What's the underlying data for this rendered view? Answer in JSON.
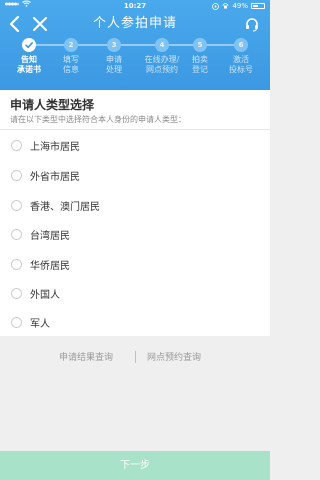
{
  "status_bar": {
    "time": "10:27",
    "battery": "49%"
  },
  "nav": {
    "title": "个人参拍申请"
  },
  "steps": [
    {
      "num": "",
      "label": "告知\n承诺书",
      "active": true
    },
    {
      "num": "2",
      "label": "填写\n信息",
      "active": false
    },
    {
      "num": "3",
      "label": "申请\n处理",
      "active": false
    },
    {
      "num": "4",
      "label": "在线办理/\n网点预约",
      "active": false
    },
    {
      "num": "5",
      "label": "拍卖\n登记",
      "active": false
    },
    {
      "num": "6",
      "label": "激活\n投标号",
      "active": false
    }
  ],
  "card": {
    "heading": "申请人类型选择",
    "subtitle": "请在以下类型中选择符合本人身份的申请人类型：",
    "options": [
      "上海市居民",
      "外省市居民",
      "香港、澳门居民",
      "台湾居民",
      "华侨居民",
      "外国人",
      "军人"
    ]
  },
  "links": {
    "result_query": "申请结果查询",
    "branch_query": "网点预约查询"
  },
  "next_button": "下一步",
  "colors": {
    "header": "#3b98e2",
    "next_button": "#a8e2c9"
  }
}
